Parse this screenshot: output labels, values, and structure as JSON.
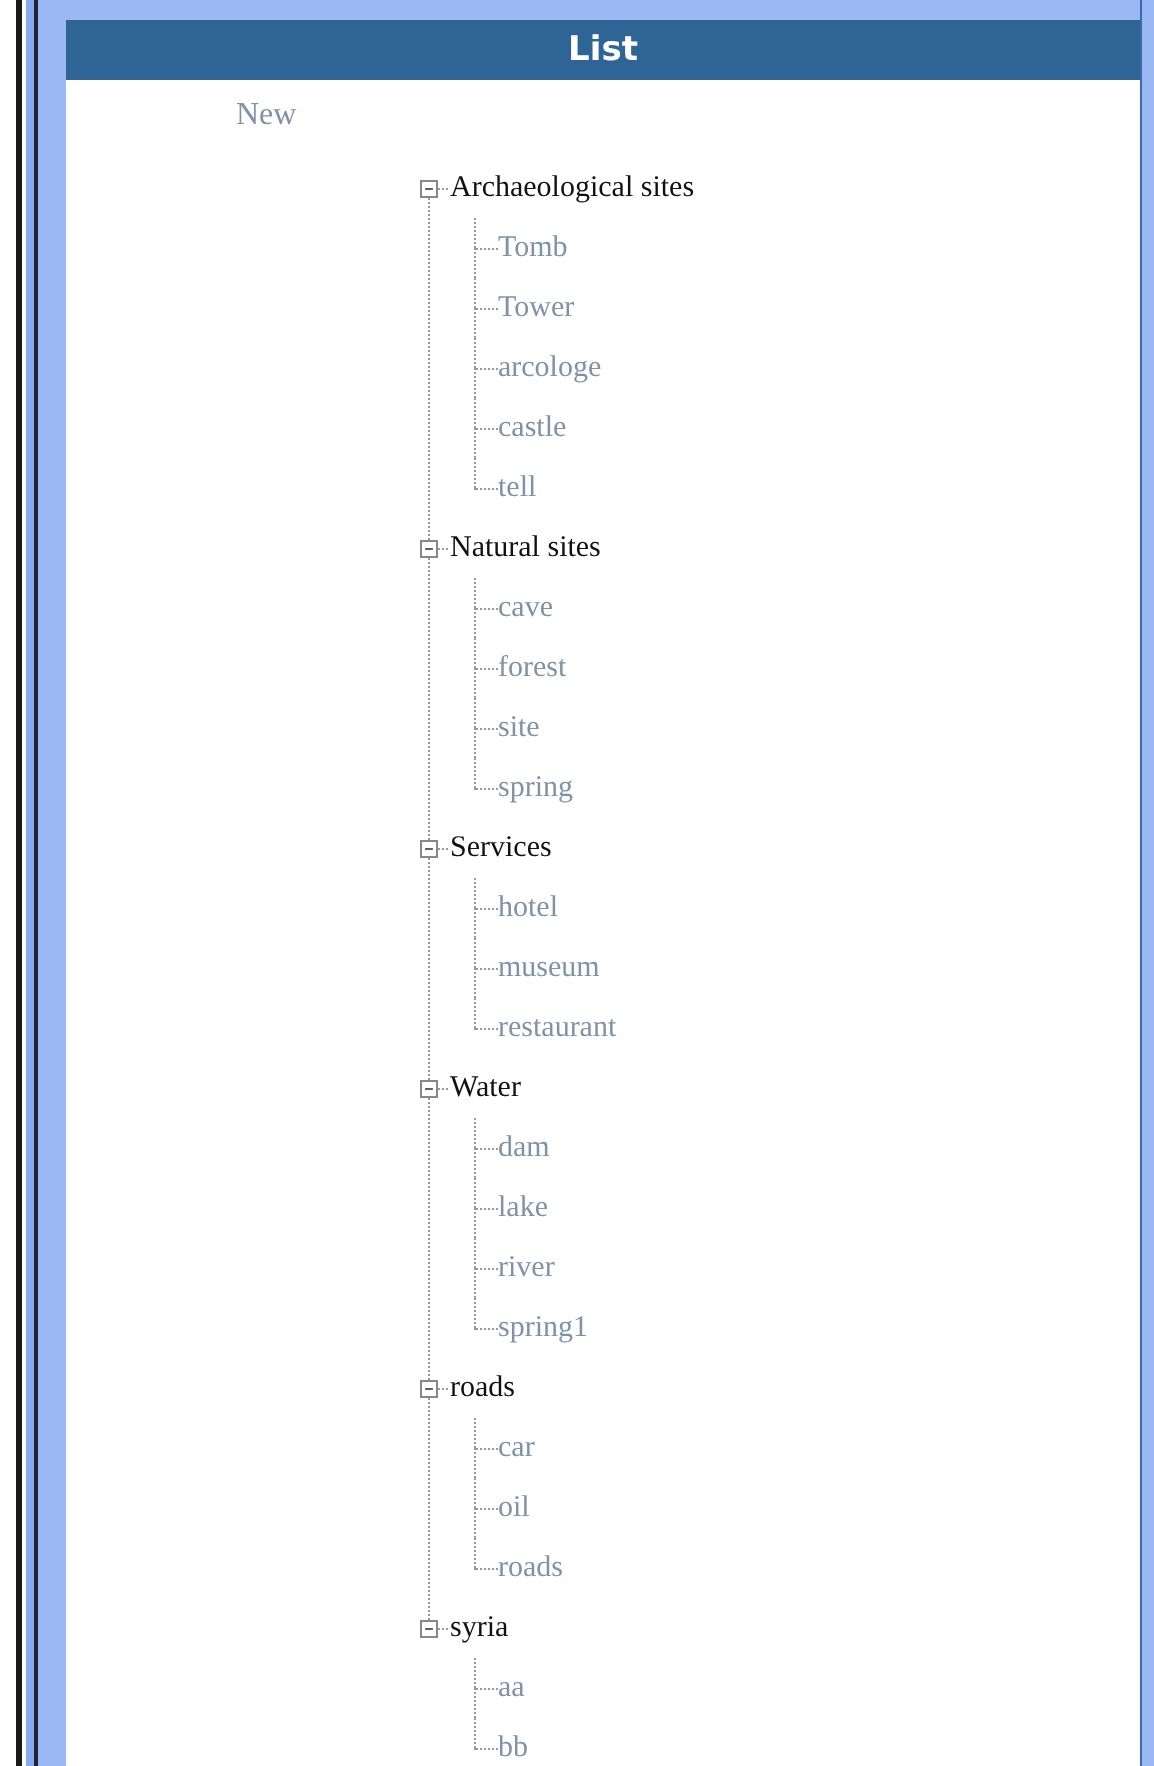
{
  "panel": {
    "title": "List"
  },
  "new_link": "New",
  "tree": [
    {
      "label": "Archaeological sites",
      "expanded": true,
      "children": [
        {
          "label": "Tomb"
        },
        {
          "label": "Tower"
        },
        {
          "label": "arcologe"
        },
        {
          "label": "castle"
        },
        {
          "label": "tell"
        }
      ]
    },
    {
      "label": "Natural sites",
      "expanded": true,
      "children": [
        {
          "label": "cave"
        },
        {
          "label": "forest"
        },
        {
          "label": "site"
        },
        {
          "label": "spring"
        }
      ]
    },
    {
      "label": "Services",
      "expanded": true,
      "children": [
        {
          "label": "hotel"
        },
        {
          "label": "museum"
        },
        {
          "label": "restaurant"
        }
      ]
    },
    {
      "label": "Water",
      "expanded": true,
      "children": [
        {
          "label": "dam"
        },
        {
          "label": "lake"
        },
        {
          "label": "river"
        },
        {
          "label": "spring1"
        }
      ]
    },
    {
      "label": "roads",
      "expanded": true,
      "children": [
        {
          "label": "car"
        },
        {
          "label": "oil"
        },
        {
          "label": "roads"
        }
      ]
    },
    {
      "label": "syria",
      "expanded": true,
      "children": [
        {
          "label": "aa"
        },
        {
          "label": "bb"
        }
      ]
    }
  ]
}
